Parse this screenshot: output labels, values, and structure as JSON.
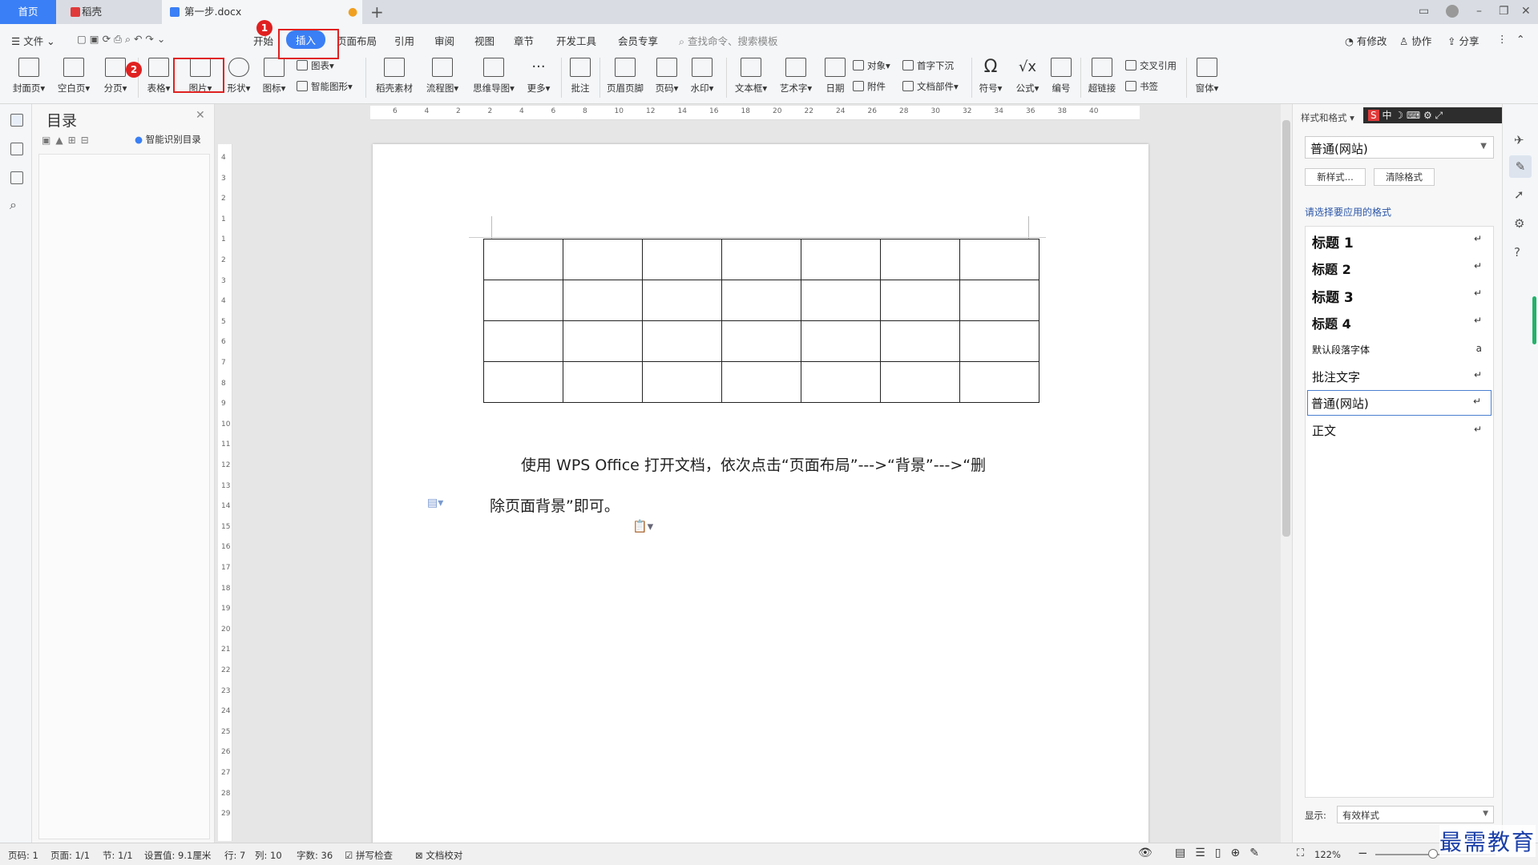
{
  "tabs": {
    "home": "首页",
    "daoke": "稻壳",
    "doc": "第一步.docx"
  },
  "menu": {
    "file": "文件",
    "start": "开始",
    "insert": "插入",
    "layout": "页面布局",
    "ref": "引用",
    "review": "审阅",
    "view": "视图",
    "chapter": "章节",
    "dev": "开发工具",
    "member": "会员专享",
    "search": "查找命令、搜索模板",
    "modified": "有修改",
    "collab": "协作",
    "share": "分享"
  },
  "ribbon": {
    "cover": "封面页",
    "blank": "空白页",
    "pagebreak": "分页",
    "table": "表格",
    "picture": "图片",
    "shape": "形状",
    "icon": "图标",
    "chart": "图表",
    "smartart": "智能图形",
    "daoke_material": "稻壳素材",
    "flowchart": "流程图",
    "mindmap": "思维导图",
    "more": "更多",
    "comment": "批注",
    "header_footer": "页眉页脚",
    "pagenum": "页码",
    "watermark": "水印",
    "textbox": "文本框",
    "wordart": "艺术字",
    "date": "日期",
    "object": "对象",
    "attachment": "附件",
    "dropcap": "首字下沉",
    "docpart": "文档部件",
    "symbol": "符号",
    "formula": "公式",
    "number": "编号",
    "hyperlink": "超链接",
    "crossref": "交叉引用",
    "bookmark": "书签",
    "form": "窗体"
  },
  "toc": {
    "title": "目录",
    "smart": "智能识别目录"
  },
  "doc": {
    "para1": "使用 WPS Office 打开文档，依次点击“页面布局”--->“背景”--->“删",
    "para2": "除页面背景”即可。"
  },
  "styles": {
    "header": "样式和格式",
    "current": "普通(网站)",
    "new_btn": "新样式...",
    "clear_btn": "清除格式",
    "prompt": "请选择要应用的格式",
    "items": [
      "标题 1",
      "标题 2",
      "标题 3",
      "标题 4",
      "默认段落字体",
      "批注文字",
      "普通(网站)",
      "正文"
    ],
    "show_label": "显示:",
    "show_value": "有效样式"
  },
  "status": {
    "page": "页码: 1",
    "pages": "页面: 1/1",
    "section": "节: 1/1",
    "setting": "设置值: 9.1厘米",
    "row": "行: 7",
    "col": "列: 10",
    "words": "字数: 36",
    "spell": "拼写检查",
    "proof": "文档校对",
    "zoom": "122%"
  },
  "badges": {
    "b1": "1",
    "b2": "2"
  },
  "watermark": "最需教育",
  "ruler_h": [
    "6",
    "4",
    "2",
    "2",
    "4",
    "6",
    "8",
    "10",
    "12",
    "14",
    "16",
    "18",
    "20",
    "22",
    "24",
    "26",
    "28",
    "30",
    "32",
    "34",
    "36",
    "38",
    "40"
  ],
  "ruler_v": [
    "4",
    "3",
    "2",
    "1",
    "1",
    "2",
    "3",
    "4",
    "5",
    "6",
    "7",
    "8",
    "9",
    "10",
    "11",
    "12",
    "13",
    "14",
    "15",
    "16",
    "17",
    "18",
    "19",
    "20",
    "21",
    "22",
    "23",
    "24",
    "25",
    "26",
    "27",
    "28",
    "29"
  ]
}
